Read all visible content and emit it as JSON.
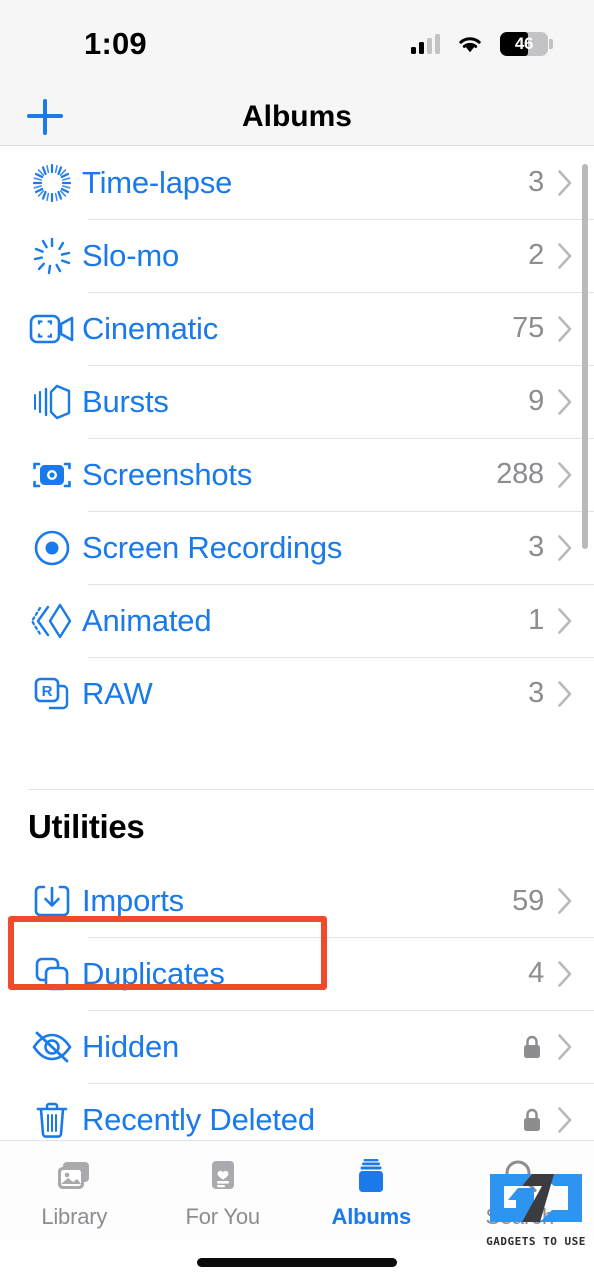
{
  "status_bar": {
    "time": "1:09",
    "battery_percent": "46",
    "signal_icon": "cellular-signal-icon",
    "wifi_icon": "wifi-icon",
    "battery_icon": "battery-icon"
  },
  "nav": {
    "title": "Albums",
    "add_icon": "plus-icon"
  },
  "sections": [
    {
      "title": "",
      "rows": [
        {
          "label": "Time-lapse",
          "count": "3",
          "icon": "timelapse-icon",
          "locked": false
        },
        {
          "label": "Slo-mo",
          "count": "2",
          "icon": "slomo-icon",
          "locked": false
        },
        {
          "label": "Cinematic",
          "count": "75",
          "icon": "cinematic-video-icon",
          "locked": false
        },
        {
          "label": "Bursts",
          "count": "9",
          "icon": "bursts-icon",
          "locked": false
        },
        {
          "label": "Screenshots",
          "count": "288",
          "icon": "screenshots-camera-icon",
          "locked": false
        },
        {
          "label": "Screen Recordings",
          "count": "3",
          "icon": "screen-recording-icon",
          "locked": false
        },
        {
          "label": "Animated",
          "count": "1",
          "icon": "animated-icon",
          "locked": false
        },
        {
          "label": "RAW",
          "count": "3",
          "icon": "raw-icon",
          "locked": false
        }
      ]
    },
    {
      "title": "Utilities",
      "rows": [
        {
          "label": "Imports",
          "count": "59",
          "icon": "import-tray-icon",
          "locked": false
        },
        {
          "label": "Duplicates",
          "count": "4",
          "icon": "duplicates-icon",
          "locked": false,
          "highlighted": true
        },
        {
          "label": "Hidden",
          "count": "",
          "icon": "eye-slash-icon",
          "locked": true
        },
        {
          "label": "Recently Deleted",
          "count": "",
          "icon": "trash-icon",
          "locked": true
        }
      ]
    }
  ],
  "tabs": [
    {
      "label": "Library",
      "icon": "photos-library-icon",
      "active": false
    },
    {
      "label": "For You",
      "icon": "for-you-card-icon",
      "active": false
    },
    {
      "label": "Albums",
      "icon": "albums-stack-icon",
      "active": true
    },
    {
      "label": "Search",
      "icon": "search-magnifier-icon",
      "active": false
    }
  ],
  "watermark": {
    "text": "GADGETS TO USE"
  },
  "colors": {
    "accent_blue": "#1a7aea",
    "highlight_red": "#f04a2a",
    "count_gray": "#8c8c91",
    "chrome_gray": "#f6f6f7"
  }
}
